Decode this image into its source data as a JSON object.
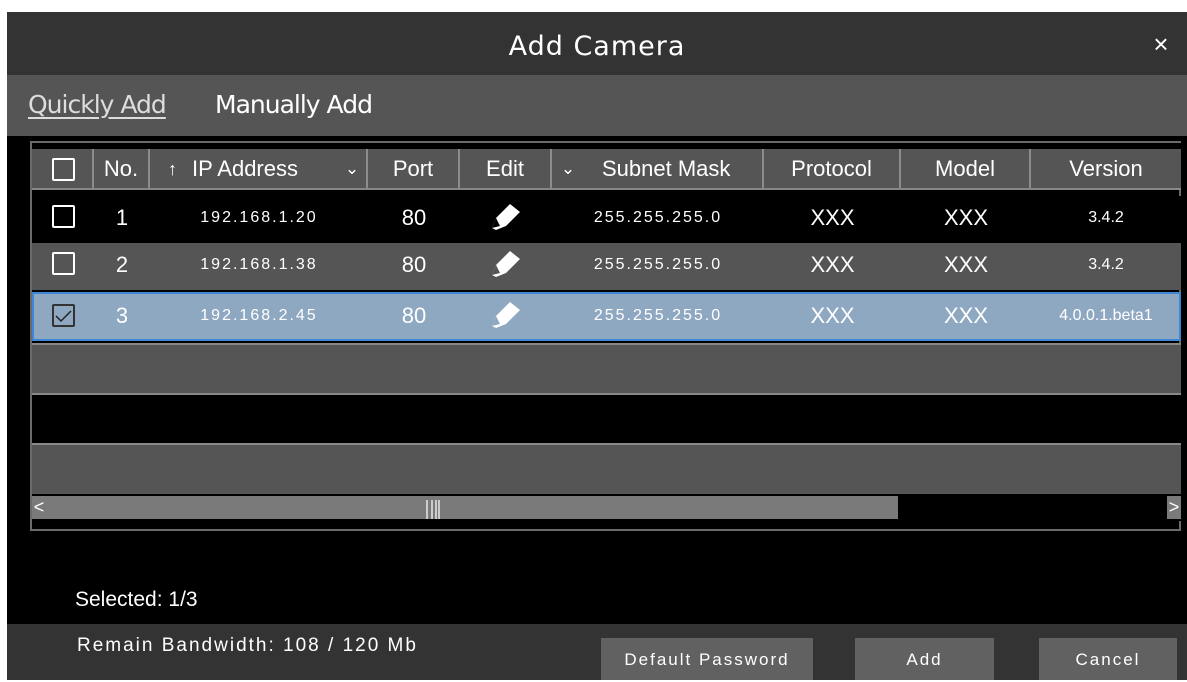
{
  "dialog": {
    "title": "Add Camera",
    "close_glyph": "×"
  },
  "tabs": [
    {
      "label": "Quickly Add",
      "active": true
    },
    {
      "label": "Manually Add",
      "active": false
    }
  ],
  "columns": {
    "no": "No.",
    "ip_sort_glyph": "↑",
    "ip": "IP Address",
    "port": "Port",
    "edit": "Edit",
    "mask": "Subnet Mask",
    "protocol": "Protocol",
    "model": "Model",
    "version": "Version"
  },
  "rows": [
    {
      "no": "1",
      "ip": "192.168.1.20",
      "port": "80",
      "mask": "255.255.255.0",
      "protocol": "XXX",
      "model": "XXX",
      "version": "3.4.2",
      "checked": false
    },
    {
      "no": "2",
      "ip": "192.168.1.38",
      "port": "80",
      "mask": "255.255.255.0",
      "protocol": "XXX",
      "model": "XXX",
      "version": "3.4.2",
      "checked": false
    },
    {
      "no": "3",
      "ip": "192.168.2.45",
      "port": "80",
      "mask": "255.255.255.0",
      "protocol": "XXX",
      "model": "XXX",
      "version": "4.0.0.1.beta1",
      "checked": true
    }
  ],
  "scrollbar": {
    "left_glyph": "<",
    "right_glyph": ">"
  },
  "status": {
    "selected": "Selected: 1/3",
    "bandwidth": "Remain Bandwidth: 108 / 120 Mb"
  },
  "buttons": {
    "default_password": "Default Password",
    "add": "Add",
    "cancel": "Cancel"
  },
  "colors": {
    "selected_row": "#8fa8c2",
    "selected_border": "#3d86d6",
    "titlebar": "#333333",
    "tabbar": "#555555"
  },
  "icons": {
    "edit": "pencil-icon",
    "close": "close-icon",
    "checkbox": "checkbox-icon",
    "dropdown": "chevron-down-icon"
  }
}
